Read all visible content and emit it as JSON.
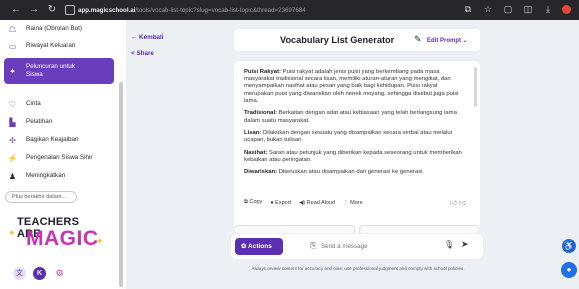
{
  "browser": {
    "url_host": "app.magicschool.ai",
    "url_path": "/tools/vocab-list-topic?slug=vocab-list-topic&thread=23697684"
  },
  "sidebar": {
    "items": [
      {
        "label": "Raina (Obrolan Bot)",
        "icon": "robot-icon"
      },
      {
        "label": "Riwayat Keluaran",
        "icon": "history-icon"
      },
      {
        "label": "Peluncuran untuk\nSiswa",
        "icon": "rocket-icon",
        "active": true
      },
      {
        "label": "Cinta",
        "icon": "heart-icon"
      },
      {
        "label": "Pelatihan",
        "icon": "training-icon"
      },
      {
        "label": "Bagikan Keajaiban",
        "icon": "share-magic-icon"
      },
      {
        "label": "Pengenalan Siswa Sihir",
        "icon": "wand-icon"
      },
      {
        "label": "Meningkatkan",
        "icon": "upgrade-icon"
      }
    ],
    "more_button": "Plus berakhir dalam...",
    "logo_line1": "TEACHERS ARE",
    "logo_line2": "MAGIC"
  },
  "main": {
    "back": "Kembali",
    "share": "Share",
    "title": "Vocabulary List Generator",
    "edit_prompt": "Edit Prompt"
  },
  "card": {
    "entries": [
      {
        "term": "Puisi Rakyat:",
        "def": " Puisi rakyat adalah jenis puisi yang berkembang pada masa masyarakat tradisional secara lisan, memiliki aturan-aturan yang mengikat, dan menyampaikan nasihat atau pesan yang baik bagi kehidupan. Puisi rakyat merupakan puisi yang diwariskan oleh nenek moyang, sehingga disebut juga puisi lama."
      },
      {
        "term": "Tradisional:",
        "def": " Berkaitan dengan adat atau kebiasaan yang telah berlangsung lama dalam suatu masyarakat."
      },
      {
        "term": "Lisan:",
        "def": " Dilakukan dengan sesuatu yang disampaikan secara verbal atau melalui ucapan, bukan tulisan."
      },
      {
        "term": "Nasihat:",
        "def": " Saran atau petunjuk yang diberikan kepada seseorang untuk memberikan kebaikan atau peringatan."
      },
      {
        "term": "Diwariskan:",
        "def": " Diteruskan atau disampaikan dari generasi ke generasi."
      }
    ],
    "actions": {
      "copy": "Copy",
      "export": "Export",
      "read_aloud": "Read Aloud",
      "more": "More"
    }
  },
  "composer": {
    "actions_label": "Actions",
    "placeholder": "Send a message",
    "disclaimer": "Always review content for accuracy and bias; use professional judgment and comply with school policies."
  },
  "colors": {
    "brand": "#5b2fb0",
    "magic_pink": "#c636b3",
    "fab_blue": "#1e6fe8"
  }
}
